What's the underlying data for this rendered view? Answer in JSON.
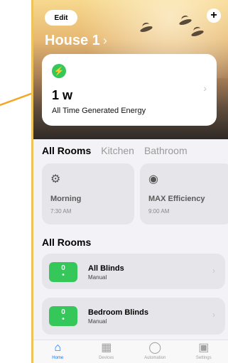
{
  "header": {
    "edit_label": "Edit",
    "home_title": "House 1",
    "add_icon": "plus-icon"
  },
  "energy_card": {
    "icon": "lightning-icon",
    "value": "1 w",
    "label": "All Time Generated Energy"
  },
  "rooms_tabs": [
    "All Rooms",
    "Kitchen",
    "Bathroom"
  ],
  "scenes": [
    {
      "icon": "gear-icon",
      "name": "Morning",
      "time": "7:30 AM"
    },
    {
      "icon": "gauge-icon",
      "name": "MAX Efficiency",
      "time": "9:00 AM"
    }
  ],
  "section_title": "All Rooms",
  "blinds": [
    {
      "toggle_value": "0",
      "name": "All Blinds",
      "mode": "Manual"
    },
    {
      "toggle_value": "0",
      "name": "Bedroom Blinds",
      "mode": "Manual"
    }
  ],
  "tabbar": [
    {
      "icon": "house-icon",
      "label": "Home"
    },
    {
      "icon": "grid-icon",
      "label": "Devices"
    },
    {
      "icon": "automation-icon",
      "label": "Automation"
    },
    {
      "icon": "settings-icon",
      "label": "Settings"
    }
  ],
  "colors": {
    "accent": "#35c759",
    "tab_active": "#1a73e8",
    "annotation_arrow": "#f5a623"
  }
}
